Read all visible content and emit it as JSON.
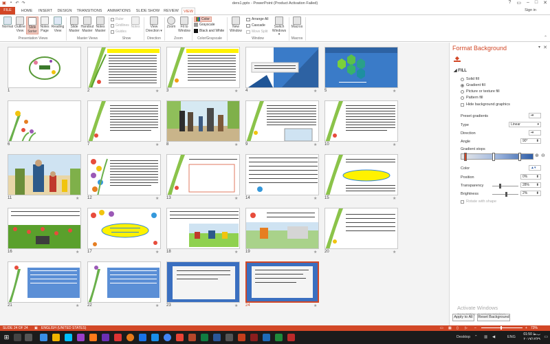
{
  "window": {
    "title": "ders1.pptx - PowerPoint (Product Activation Failed)",
    "signin": "Sign in"
  },
  "tabs": [
    "FILE",
    "HOME",
    "INSERT",
    "DESIGN",
    "TRANSITIONS",
    "ANIMATIONS",
    "SLIDE SHOW",
    "REVIEW",
    "VIEW"
  ],
  "ribbon": {
    "presentation_views": [
      "Normal",
      "Outline View",
      "Slide Sorter",
      "Notes Page",
      "Reading View"
    ],
    "master_views": [
      "Slide Master",
      "Handout Master",
      "Notes Master"
    ],
    "show": [
      "Ruler",
      "Gridlines",
      "Guides"
    ],
    "notes": "Notes",
    "direction": "View Direction",
    "zoom": [
      "Zoom",
      "Fit to Window"
    ],
    "color": [
      "Color",
      "Grayscale",
      "Black and White"
    ],
    "window_items": [
      "New Window",
      "Arrange All",
      "Cascade",
      "Move Split",
      "Switch Windows"
    ],
    "macros": "Macros",
    "groups": [
      "Presentation Views",
      "Master Views",
      "Show",
      "Direction",
      "Zoom",
      "Color/Grayscale",
      "Window",
      "Macros"
    ]
  },
  "slides": [
    {
      "n": "1"
    },
    {
      "n": "2"
    },
    {
      "n": "3"
    },
    {
      "n": "4"
    },
    {
      "n": "5"
    },
    {
      "n": "6"
    },
    {
      "n": "7"
    },
    {
      "n": "8"
    },
    {
      "n": "9"
    },
    {
      "n": "10"
    },
    {
      "n": "11"
    },
    {
      "n": "12"
    },
    {
      "n": "13"
    },
    {
      "n": "14"
    },
    {
      "n": "15"
    },
    {
      "n": "16"
    },
    {
      "n": "17"
    },
    {
      "n": "18"
    },
    {
      "n": "19"
    },
    {
      "n": "20"
    },
    {
      "n": "21"
    },
    {
      "n": "22"
    },
    {
      "n": "23"
    },
    {
      "n": "24"
    }
  ],
  "selected_slide": "24",
  "format_pane": {
    "title": "Format Background",
    "section": "FILL",
    "fill_options": [
      "Solid fill",
      "Gradient fill",
      "Picture or texture fill",
      "Pattern fill"
    ],
    "hide_bg": "Hide background graphics",
    "preset_label": "Preset gradients",
    "type_label": "Type",
    "type_value": "Linear",
    "direction_label": "Direction",
    "angle_label": "Angle",
    "angle_value": "90°",
    "stops_label": "Gradient stops",
    "color_label": "Color",
    "position_label": "Position",
    "position_value": "0%",
    "transparency_label": "Transparency",
    "transparency_value": "28%",
    "brightness_label": "Brightness",
    "brightness_value": "2%",
    "rotate_label": "Rotate with shape",
    "apply_all": "Apply to All",
    "reset": "Reset Background"
  },
  "status": {
    "slide_info": "SLIDE 24 OF 24",
    "language": "ENGLISH (UNITED STATES)",
    "zoom": "73%"
  },
  "watermark": {
    "line1": "Activate Windows",
    "line2": "Go to Settings to activate Windows."
  },
  "taskbar": {
    "desktop": "Desktop",
    "lang": "ENG",
    "time": "01:50 ب.ظ",
    "date": "۲۰۱۹/۱۲/۲۹"
  },
  "colors": {
    "accent": "#d24726"
  }
}
